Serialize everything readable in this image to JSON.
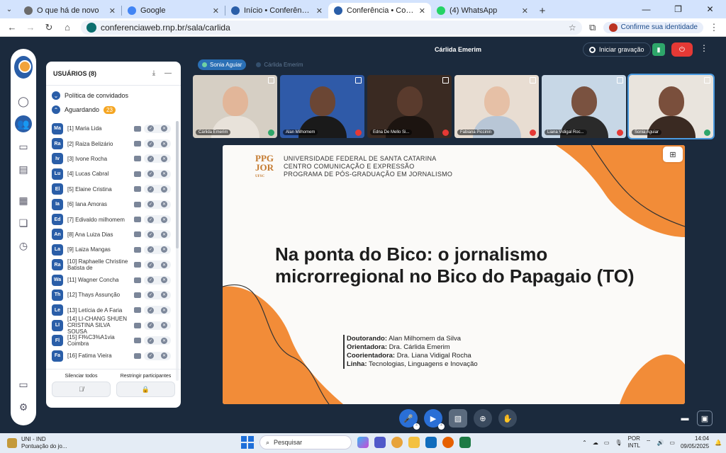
{
  "browser": {
    "tabs": [
      {
        "title": "O que há de novo",
        "favicon_color": "#6b6b6b",
        "active": false
      },
      {
        "title": "Google",
        "favicon_color": "#4285f4",
        "active": false
      },
      {
        "title": "Início • ConferênciaWeb",
        "favicon_color": "#2a5ea8",
        "active": false
      },
      {
        "title": "Conferência • ConferênciaW",
        "favicon_color": "#2a5ea8",
        "active": true
      },
      {
        "title": "(4) WhatsApp",
        "favicon_color": "#25d366",
        "active": false
      }
    ],
    "new_tab": "+",
    "url": "conferenciaweb.rnp.br/sala/carlida",
    "confirm_identity": "Confirme sua identidade"
  },
  "users_panel": {
    "title": "USUÁRIOS (8)",
    "guest_policy": "Política de convidados",
    "waiting_label": "Aguardando",
    "waiting_count": "23",
    "users": [
      {
        "initials": "Ma",
        "name": "[1] Maria Lida"
      },
      {
        "initials": "Ra",
        "name": "[2] Raiza Belizário"
      },
      {
        "initials": "Iv",
        "name": "[3] Ivone Rocha"
      },
      {
        "initials": "Lu",
        "name": "[4] Lucas Cabral"
      },
      {
        "initials": "El",
        "name": "[5] Elaine Cristina"
      },
      {
        "initials": "Ia",
        "name": "[6] Iana Amoras"
      },
      {
        "initials": "Ed",
        "name": "[7] Edivaldo milhomem"
      },
      {
        "initials": "An",
        "name": "[8] Ana Luiza Dias"
      },
      {
        "initials": "La",
        "name": "[9] Laiza Mangas"
      },
      {
        "initials": "Ra",
        "name": "[10] Raphaelle Christine Batista de"
      },
      {
        "initials": "Wa",
        "name": "[11] Wagner Concha"
      },
      {
        "initials": "Th",
        "name": "[12] Thays Assunção"
      },
      {
        "initials": "Le",
        "name": "[13] Letícia de A Faria"
      },
      {
        "initials": "LI",
        "name": "[14] LI-CHANG SHUEN CRISTINA SILVA SOUSA"
      },
      {
        "initials": "Fl",
        "name": "[15] Fl%C3%A1via Coimbra"
      },
      {
        "initials": "Fa",
        "name": "[16] Fatima Vieira"
      }
    ],
    "mute_all": "Silenciar todos",
    "restrict": "Restringir participantes"
  },
  "meeting": {
    "name": "Cárlida Emerim",
    "record": "Iniciar gravação",
    "speakers": [
      {
        "name": "Sonia Aguiar",
        "active": true
      },
      {
        "name": "Cárlida Emerim",
        "active": false
      }
    ],
    "tiles": [
      {
        "name": "Cárlida Emerim",
        "bg": "#d6cfc4",
        "skin": "#e2b699",
        "shirt": "#e8e2da",
        "mic": "on"
      },
      {
        "name": "Alan Milhomem",
        "bg": "#2f5aa8",
        "skin": "#6b4634",
        "shirt": "#1a1a1a",
        "mic": "off"
      },
      {
        "name": "Edna De Mello Si...",
        "bg": "#3a2a22",
        "skin": "#5a3b2d",
        "shirt": "#1c1410",
        "mic": "off"
      },
      {
        "name": "Fabiana Piccinin",
        "bg": "#e8ddd2",
        "skin": "#e6c0a6",
        "shirt": "#b8c6d6",
        "mic": "off"
      },
      {
        "name": "Liana Vidigal Roc...",
        "bg": "#c7d7e6",
        "skin": "#7a5240",
        "shirt": "#2a2a2a",
        "mic": "off"
      },
      {
        "name": "Sonia Aguiar",
        "bg": "#e9e4dd",
        "skin": "#7a4f3c",
        "shirt": "#3a2a22",
        "mic": "on"
      }
    ]
  },
  "slide": {
    "logo_line1": "PPG",
    "logo_line2": "JOR",
    "logo_sub": "UFSC",
    "institution": [
      "UNIVERSIDADE FEDERAL DE SANTA CATARINA",
      "CENTRO COMUNICAÇÃO E EXPRESSÃO",
      "PROGRAMA DE PÓS-GRADUAÇÃO EM JORNALISMO"
    ],
    "title_line1": "Na ponta do Bico: o jornalismo",
    "title_line2": "microrregional no Bico do Papagaio (TO)",
    "credits": [
      {
        "label": "Doutorando:",
        "value": " Alan Milhomem da Silva"
      },
      {
        "label": "Orientadora:",
        "value": " Dra. Cárlida Emerim"
      },
      {
        "label": "Coorientadora:",
        "value": " Dra. Liana Vidigal Rocha"
      },
      {
        "label": "Linha:",
        "value": " Tecnologias, Linguagens e Inovação"
      }
    ],
    "accent": "#f28c38"
  },
  "taskbar": {
    "weather_title": "UNI - IND",
    "weather_sub": "Pontuação do jo...",
    "search": "Pesquisar",
    "lang1": "POR",
    "lang2": "INTL",
    "time": "14:04",
    "date": "09/05/2025"
  }
}
